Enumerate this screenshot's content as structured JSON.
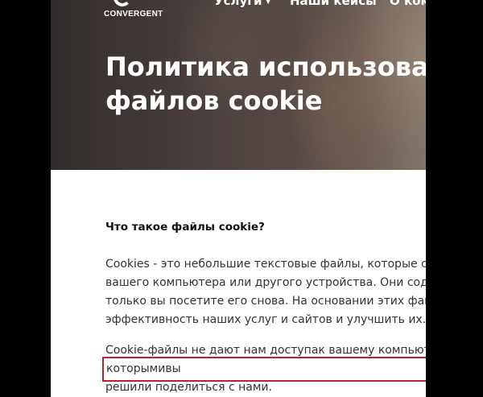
{
  "header": {
    "logo_text": "CONVERGENT",
    "nav": {
      "services": "Услуги",
      "cases": "Наши кейсы",
      "about": "О компании"
    }
  },
  "hero": {
    "title_line1": "Политика использования",
    "title_line2": "файлов cookie"
  },
  "section": {
    "heading": "Что такое файлы cookie?",
    "para1": [
      "Cookies - это небольшие текстовые файлы, которые сохраняются на диске",
      "вашего компьютера или другого устройства. Они содержат информацию,",
      "только вы посетите его снова. На основании этих файлов мы можем повысить",
      "эффективность наших услуг и сайтов и улучшить их."
    ],
    "para2_line1": "Cookie-файлы не дают нам доступак вашему компьютеру или информации,",
    "para2_highlight": "которымивы",
    "para2_line2_rest": " решили поделиться с нами."
  },
  "colors": {
    "highlight_border": "#c5202a",
    "page_background": "#ffffff",
    "outer_background": "#000000"
  }
}
